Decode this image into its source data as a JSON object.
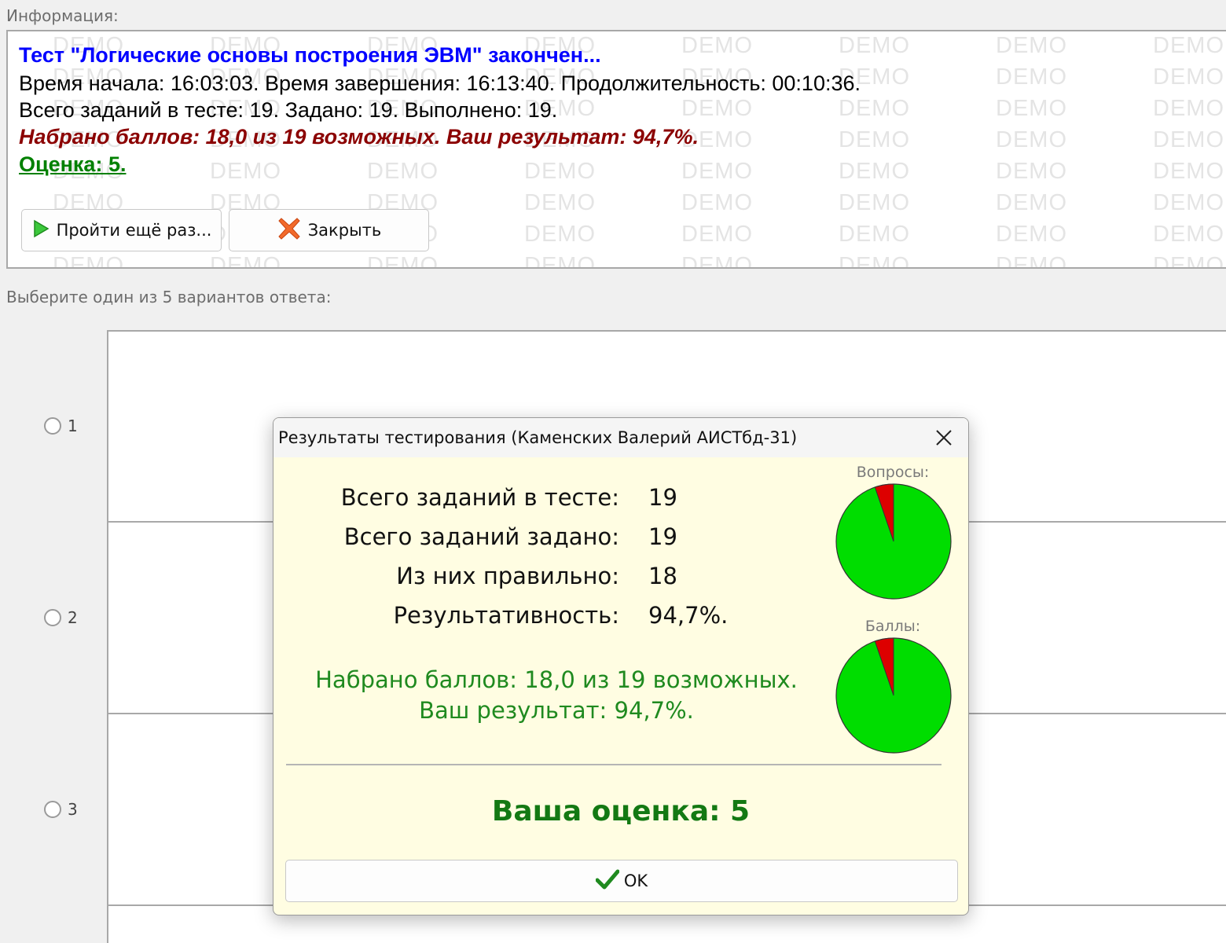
{
  "info": {
    "label": "Информация:",
    "watermark": "DEMO",
    "title": "Тест \"Логические основы построения ЭВМ\" закончен...",
    "times": "Время начала: 16:03:03. Время завершения: 16:13:40. Продолжительность: 00:10:36.",
    "tasks": "Всего заданий в тесте: 19. Задано: 19. Выполнено: 19.",
    "score": "Набрано баллов: 18,0 из 19 возможных. Ваш результат: 94,7%.",
    "grade": "Оценка: 5.",
    "retry_button": "Пройти ещё раз...",
    "close_button": "Закрыть"
  },
  "question": {
    "prompt": "Выберите один из 5 вариантов ответа:",
    "options": [
      "1",
      "2",
      "3"
    ]
  },
  "dialog": {
    "title": "Результаты тестирования (Каменских Валерий АИСТбд-31)",
    "stats": [
      {
        "label": "Всего заданий в тесте:",
        "value": "19"
      },
      {
        "label": "Всего заданий задано:",
        "value": "19"
      },
      {
        "label": "Из них правильно:",
        "value": "18"
      },
      {
        "label": "Результативность:",
        "value": "94,7%."
      }
    ],
    "points_line": "Набрано баллов: 18,0 из 19 возможных.",
    "result_line": "Ваш результат: 94,7%.",
    "grade_line": "Ваша оценка: 5",
    "ok_button": "OK",
    "pies": [
      {
        "caption": "Вопросы:",
        "correct": 18,
        "total": 19
      },
      {
        "caption": "Баллы:",
        "correct": 18,
        "total": 19
      }
    ]
  },
  "colors": {
    "pie_correct": "#00dd00",
    "pie_wrong": "#dd0000",
    "title_blue": "#0000ff",
    "score_red": "#8b0000",
    "grade_green": "#008000"
  }
}
